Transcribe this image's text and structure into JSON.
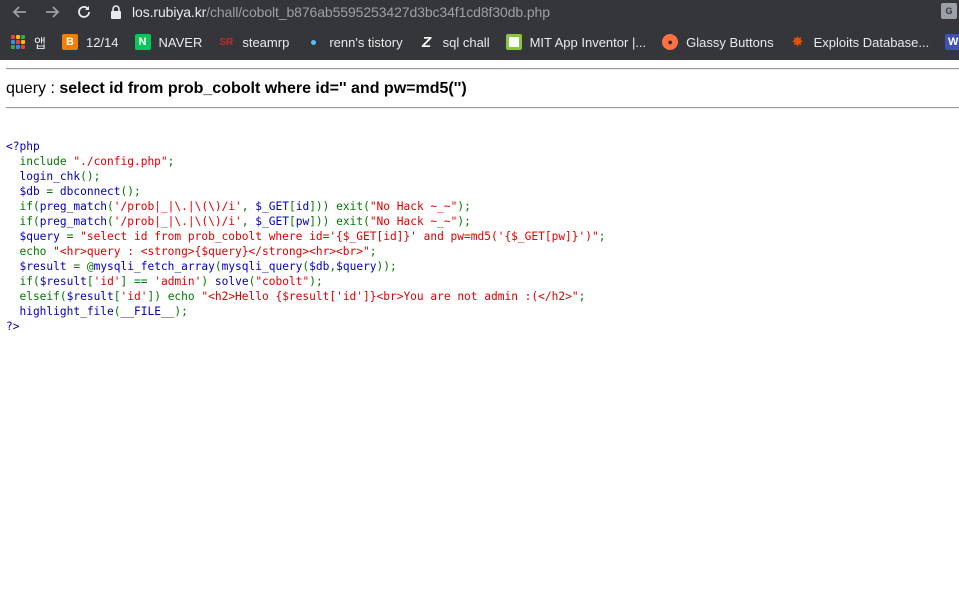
{
  "browser": {
    "url_host": "los.rubiya.kr",
    "url_path": "/chall/cobolt_b876ab5595253427d3bc34f1cd8f30db.php",
    "icons": {
      "back": "arrow-left-icon",
      "forward": "arrow-right-icon",
      "reload": "reload-icon",
      "lock": "lock-icon",
      "translate": "translate-icon"
    }
  },
  "bookmarks": [
    {
      "label": "앱",
      "icon": "apps-grid-icon"
    },
    {
      "label": "12/14",
      "icon": "blogger-icon",
      "color": "#f57d00"
    },
    {
      "label": "NAVER",
      "icon": "naver-icon",
      "color": "#03c75a"
    },
    {
      "label": "steamrp",
      "icon": "sr-icon",
      "color": "#c62828"
    },
    {
      "label": "renn's tistory",
      "icon": "dot-icon",
      "color": "#4fc3f7"
    },
    {
      "label": "sql chall",
      "icon": "z-icon",
      "color": "#ffffff"
    },
    {
      "label": "MIT App Inventor |...",
      "icon": "app-inventor-icon",
      "color": "#8bc34a"
    },
    {
      "label": "Glassy Buttons",
      "icon": "glassy-icon",
      "color": "#ff7043"
    },
    {
      "label": "Exploits Database...",
      "icon": "exploit-db-icon",
      "color": "#e65100"
    },
    {
      "label": "[W",
      "icon": "w-icon",
      "color": "#3f51b5"
    }
  ],
  "page": {
    "query_prefix": "query : ",
    "query_sql": "select id from prob_cobolt where id='' and pw=md5('')",
    "code_lines": [
      [
        {
          "t": "default",
          "s": "<?php"
        }
      ],
      [
        {
          "t": "keyword",
          "s": "  include "
        },
        {
          "t": "string",
          "s": "\"./config.php\""
        },
        {
          "t": "keyword",
          "s": ";"
        }
      ],
      [
        {
          "t": "default",
          "s": "  login_chk"
        },
        {
          "t": "keyword",
          "s": "();"
        }
      ],
      [
        {
          "t": "default",
          "s": "  $db "
        },
        {
          "t": "keyword",
          "s": "= "
        },
        {
          "t": "default",
          "s": "dbconnect"
        },
        {
          "t": "keyword",
          "s": "();"
        }
      ],
      [
        {
          "t": "keyword",
          "s": "  if("
        },
        {
          "t": "default",
          "s": "preg_match"
        },
        {
          "t": "keyword",
          "s": "("
        },
        {
          "t": "string",
          "s": "'/prob|_|\\.|\\(\\)/i'"
        },
        {
          "t": "keyword",
          "s": ", "
        },
        {
          "t": "default",
          "s": "$_GET"
        },
        {
          "t": "keyword",
          "s": "["
        },
        {
          "t": "default",
          "s": "id"
        },
        {
          "t": "keyword",
          "s": "])) exit("
        },
        {
          "t": "string",
          "s": "\"No Hack ~_~\""
        },
        {
          "t": "keyword",
          "s": ");"
        }
      ],
      [
        {
          "t": "keyword",
          "s": "  if("
        },
        {
          "t": "default",
          "s": "preg_match"
        },
        {
          "t": "keyword",
          "s": "("
        },
        {
          "t": "string",
          "s": "'/prob|_|\\.|\\(\\)/i'"
        },
        {
          "t": "keyword",
          "s": ", "
        },
        {
          "t": "default",
          "s": "$_GET"
        },
        {
          "t": "keyword",
          "s": "["
        },
        {
          "t": "default",
          "s": "pw"
        },
        {
          "t": "keyword",
          "s": "])) exit("
        },
        {
          "t": "string",
          "s": "\"No Hack ~_~\""
        },
        {
          "t": "keyword",
          "s": ");"
        }
      ],
      [
        {
          "t": "default",
          "s": "  $query "
        },
        {
          "t": "keyword",
          "s": "= "
        },
        {
          "t": "string",
          "s": "\"select id from prob_cobolt where id='{$_GET[id]}' and pw=md5('{$_GET[pw]}')\""
        },
        {
          "t": "keyword",
          "s": ";"
        }
      ],
      [
        {
          "t": "keyword",
          "s": "  echo "
        },
        {
          "t": "string",
          "s": "\"<hr>query : <strong>{$query}</strong><hr><br>\""
        },
        {
          "t": "keyword",
          "s": ";"
        }
      ],
      [
        {
          "t": "default",
          "s": "  $result "
        },
        {
          "t": "keyword",
          "s": "= @"
        },
        {
          "t": "default",
          "s": "mysqli_fetch_array"
        },
        {
          "t": "keyword",
          "s": "("
        },
        {
          "t": "default",
          "s": "mysqli_query"
        },
        {
          "t": "keyword",
          "s": "("
        },
        {
          "t": "default",
          "s": "$db"
        },
        {
          "t": "keyword",
          "s": ","
        },
        {
          "t": "default",
          "s": "$query"
        },
        {
          "t": "keyword",
          "s": "));"
        }
      ],
      [
        {
          "t": "keyword",
          "s": "  if("
        },
        {
          "t": "default",
          "s": "$result"
        },
        {
          "t": "keyword",
          "s": "["
        },
        {
          "t": "string",
          "s": "'id'"
        },
        {
          "t": "keyword",
          "s": "] == "
        },
        {
          "t": "string",
          "s": "'admin'"
        },
        {
          "t": "keyword",
          "s": ") "
        },
        {
          "t": "default",
          "s": "solve"
        },
        {
          "t": "keyword",
          "s": "("
        },
        {
          "t": "string",
          "s": "\"cobolt\""
        },
        {
          "t": "keyword",
          "s": ");"
        }
      ],
      [
        {
          "t": "keyword",
          "s": "  elseif("
        },
        {
          "t": "default",
          "s": "$result"
        },
        {
          "t": "keyword",
          "s": "["
        },
        {
          "t": "string",
          "s": "'id'"
        },
        {
          "t": "keyword",
          "s": "]) echo "
        },
        {
          "t": "string",
          "s": "\"<h2>Hello {$result['id']}<br>You are not admin :(</h2>\""
        },
        {
          "t": "keyword",
          "s": ";"
        }
      ],
      [
        {
          "t": "default",
          "s": "  highlight_file"
        },
        {
          "t": "keyword",
          "s": "("
        },
        {
          "t": "default",
          "s": "__FILE__"
        },
        {
          "t": "keyword",
          "s": ");"
        }
      ],
      [
        {
          "t": "default",
          "s": "?>"
        }
      ]
    ]
  },
  "colors": {
    "chrome_bg": "#35363a",
    "php_default": "#0000bb",
    "php_keyword": "#007700",
    "php_string": "#dd0000"
  }
}
